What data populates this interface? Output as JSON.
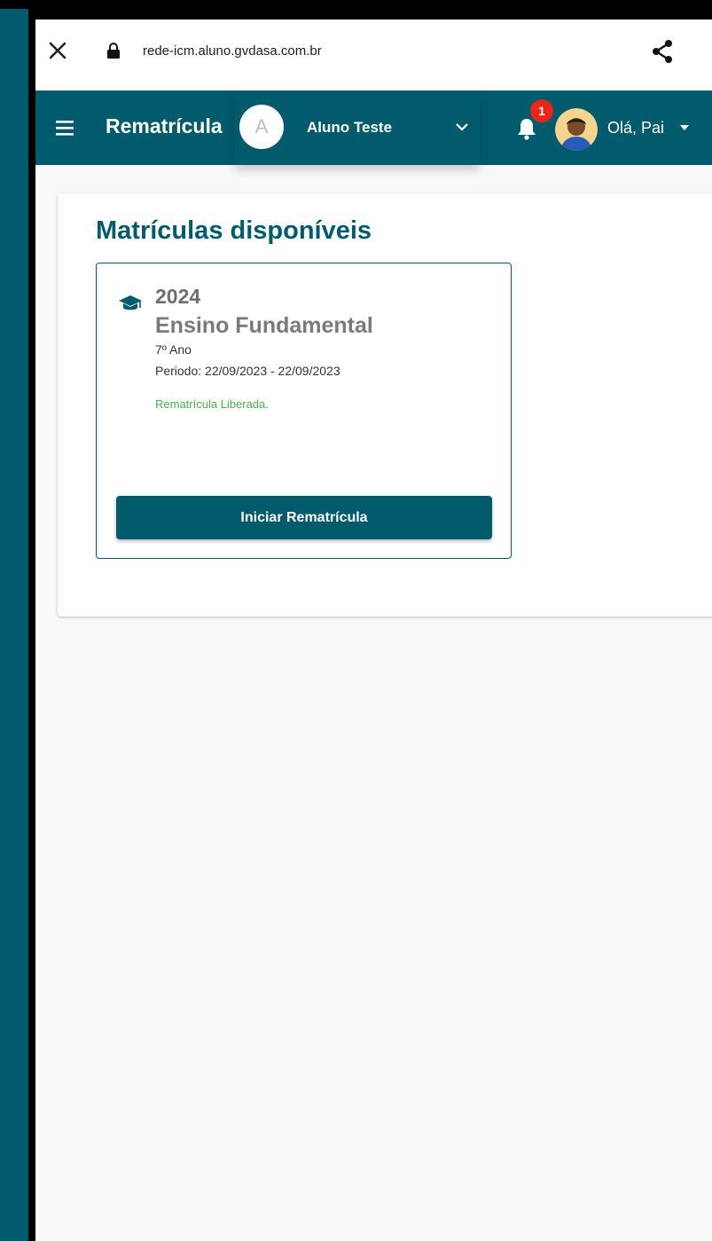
{
  "browser": {
    "url": "rede-icm.aluno.gvdasa.com.br",
    "icons": [
      "close-icon",
      "lock-icon",
      "share-icon"
    ]
  },
  "header": {
    "title": "Rematrícula",
    "student": {
      "initial": "A",
      "name": "Aluno Teste"
    },
    "notification_count": "1",
    "greeting": "Olá, Pai",
    "icons": [
      "menu-icon",
      "chevron-down-icon",
      "bell-icon",
      "caret-down-icon"
    ]
  },
  "main": {
    "section_title": "Matrículas disponíveis",
    "enrollment": {
      "year": "2024",
      "level": "Ensino Fundamental",
      "grade": "7º Ano",
      "period": "Periodo: 22/09/2023 - 22/09/2023",
      "status": "Rematrícula Liberada.",
      "button_label": "Iniciar Rematrícula",
      "icon": "graduation-cap-icon"
    }
  },
  "colors": {
    "primary": "#015b6d",
    "status_green": "#4caf50",
    "badge_red": "#e8261c",
    "background": "#f9f9f9"
  }
}
